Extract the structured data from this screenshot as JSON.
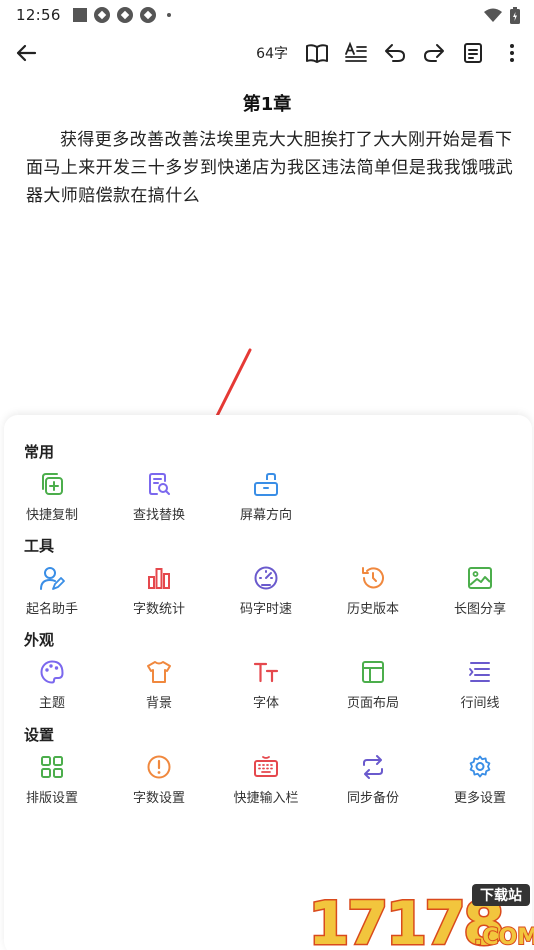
{
  "status_bar": {
    "time": "12:56"
  },
  "toolbar": {
    "word_count": "64字"
  },
  "chapter": {
    "title": "第1章",
    "body": "获得更多改善改善法埃里克大大胆挨打了大大刚开始是看下面马上来开发三十多岁到快递店为我区违法简单但是我我饿哦武器大师赔偿款在搞什么"
  },
  "panel": {
    "sections": [
      {
        "title": "常用",
        "items": [
          {
            "label": "快捷复制",
            "icon": "copy-plus-icon",
            "color": "#4cae4c"
          },
          {
            "label": "查找替换",
            "icon": "find-replace-icon",
            "color": "#7b68ee"
          },
          {
            "label": "屏幕方向",
            "icon": "screen-rotate-icon",
            "color": "#3a8ee6"
          }
        ]
      },
      {
        "title": "工具",
        "items": [
          {
            "label": "起名助手",
            "icon": "name-assistant-icon",
            "color": "#3a8ee6"
          },
          {
            "label": "字数统计",
            "icon": "word-stats-icon",
            "color": "#e5484d"
          },
          {
            "label": "码字时速",
            "icon": "speedometer-icon",
            "color": "#6a5acd"
          },
          {
            "label": "历史版本",
            "icon": "history-icon",
            "color": "#f0883e"
          },
          {
            "label": "长图分享",
            "icon": "image-share-icon",
            "color": "#4cae4c"
          }
        ]
      },
      {
        "title": "外观",
        "items": [
          {
            "label": "主题",
            "icon": "palette-icon",
            "color": "#7b68ee"
          },
          {
            "label": "背景",
            "icon": "tshirt-icon",
            "color": "#f0883e"
          },
          {
            "label": "字体",
            "icon": "font-icon",
            "color": "#e5484d"
          },
          {
            "label": "页面布局",
            "icon": "layout-icon",
            "color": "#4cae4c"
          },
          {
            "label": "行间线",
            "icon": "line-spacing-icon",
            "color": "#6a5acd"
          }
        ]
      },
      {
        "title": "设置",
        "items": [
          {
            "label": "排版设置",
            "icon": "grid-icon",
            "color": "#4cae4c"
          },
          {
            "label": "字数设置",
            "icon": "alert-circle-icon",
            "color": "#f0883e"
          },
          {
            "label": "快捷输入栏",
            "icon": "keyboard-icon",
            "color": "#e5484d"
          },
          {
            "label": "同步备份",
            "icon": "sync-icon",
            "color": "#6a5acd"
          },
          {
            "label": "更多设置",
            "icon": "gear-icon",
            "color": "#3a8ee6"
          }
        ]
      }
    ]
  },
  "watermark": {
    "number": "17178",
    "tag": "下载站",
    "domain": ".COM"
  }
}
